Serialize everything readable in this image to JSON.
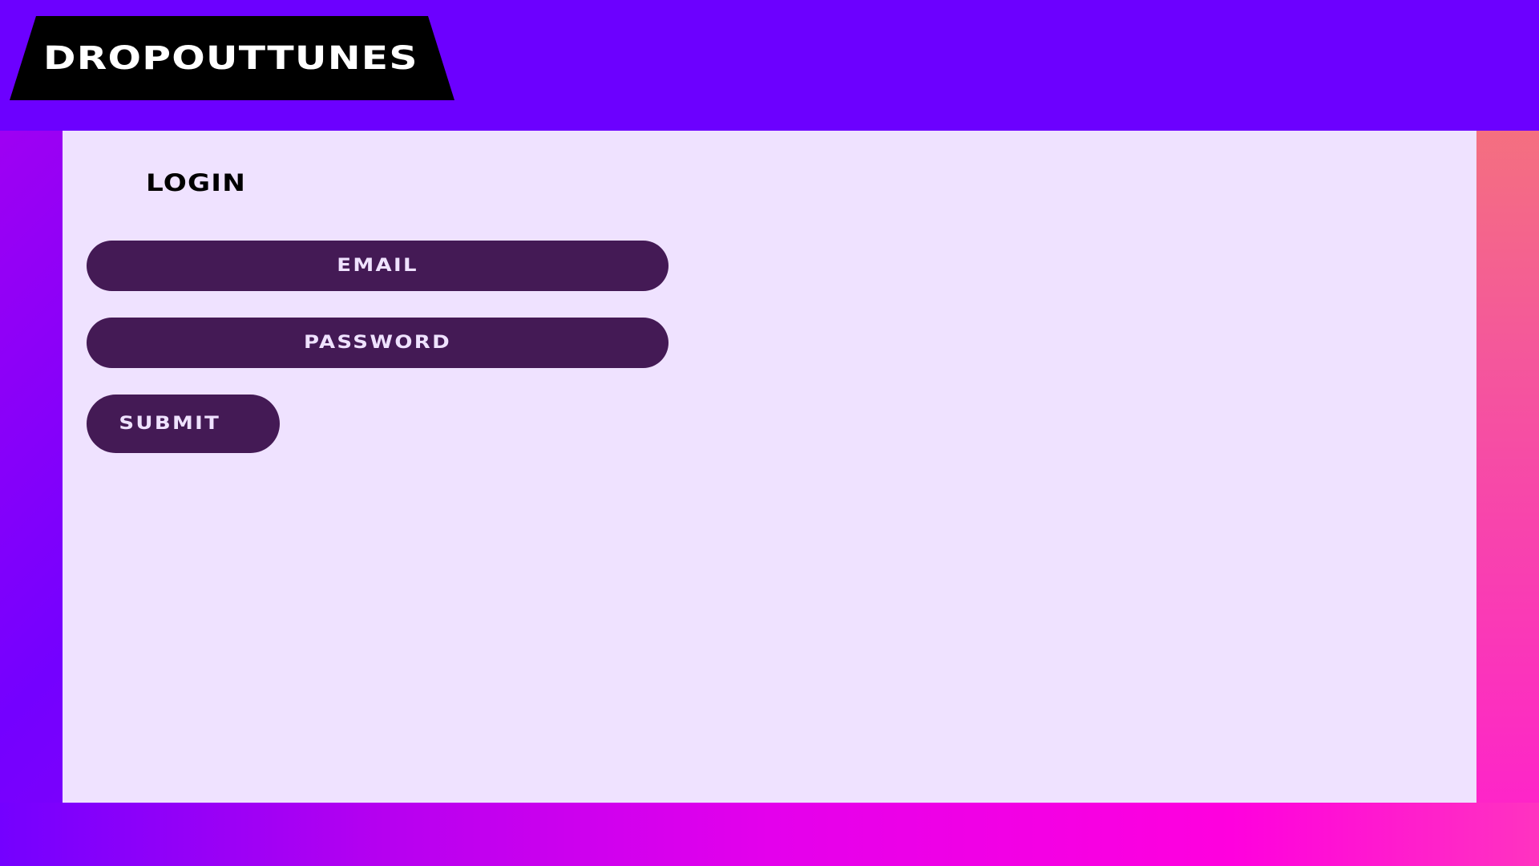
{
  "app": {
    "brand": "DROPOUTTUNES"
  },
  "login": {
    "title": "LOGIN",
    "email_label": "EMAIL",
    "password_label": "PASSWORD",
    "submit_label": "SUBMIT"
  },
  "colors": {
    "header": "#6c00ff",
    "panel": "#efe2ff",
    "button": "#441a55",
    "logo_plate": "#000000"
  }
}
